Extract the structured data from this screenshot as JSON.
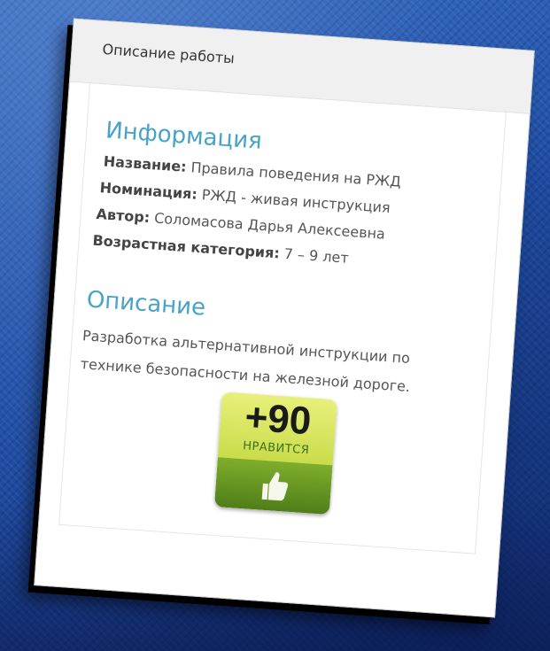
{
  "card": {
    "header_title": "Описание работы",
    "info_section": {
      "title": "Информация",
      "fields": [
        {
          "label": "Название:",
          "value": "Правила поведения на РЖД"
        },
        {
          "label": "Номинация:",
          "value": "РЖД - живая инструкция"
        },
        {
          "label": "Автор:",
          "value": "Соломасова Дарья Алексеевна"
        },
        {
          "label": "Возрастная категория:",
          "value": "7 – 9 лет"
        }
      ]
    },
    "description_section": {
      "title": "Описание",
      "text": "Разработка альтернативной инструкции по технике безопасности на железной дороге."
    },
    "like_badge": {
      "count": "+90",
      "label": "НРАВИТСЯ",
      "icon": "thumbs-up-icon",
      "colors": {
        "top": "#d6e45a",
        "bottom": "#5f8f1f"
      }
    }
  },
  "colors": {
    "accent": "#49a3c9",
    "background": "#1f4ea6"
  }
}
